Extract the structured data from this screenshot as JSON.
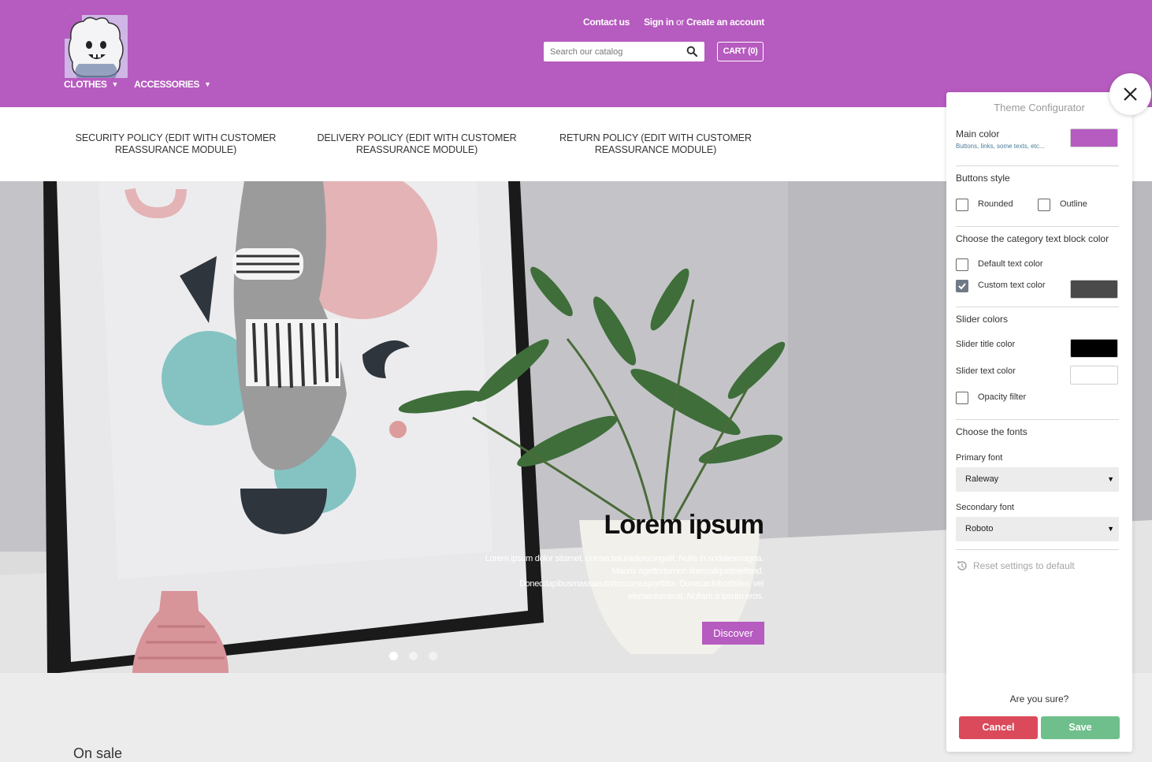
{
  "header": {
    "contact": "Contact us",
    "signin": "Sign in",
    "or": "or",
    "create_account": "Create an account",
    "search_placeholder": "Search our catalog",
    "cart": "CART (0)",
    "menu": [
      {
        "label": "CLOTHES"
      },
      {
        "label": "ACCESSORIES"
      }
    ],
    "brand_color": "#b65bbf"
  },
  "reassurance": [
    {
      "line1": "SECURITY POLICY (EDIT WITH CUSTOMER",
      "line2": "REASSURANCE MODULE)"
    },
    {
      "line1": "DELIVERY POLICY (EDIT WITH CUSTOMER",
      "line2": "REASSURANCE MODULE)"
    },
    {
      "line1": "RETURN POLICY (EDIT WITH CUSTOMER",
      "line2": "REASSURANCE MODULE)"
    }
  ],
  "hero": {
    "title": "Lorem ipsum",
    "text": "Lorem ipsum dolor sitamet, consecteturadipiscingelit. Nulla in sodalesmagna. Mauris egettortornon liberoaliqueteleifend. Donecdapibusmassaeutortorcursusporttitor. Donecaclobortisleo, vel elementumerat. Nullam a ipsum eros.",
    "button": "Discover",
    "active_slide": 1,
    "slide_count": 3
  },
  "section": {
    "on_sale": "On sale"
  },
  "configurator": {
    "title": "Theme Configurator",
    "main_color_label": "Main color",
    "main_color_hint": "Buttons, links, some texts, etc...",
    "main_color": "#b65bbf",
    "buttons_style_label": "Buttons style",
    "rounded": "Rounded",
    "outline": "Outline",
    "rounded_checked": false,
    "outline_checked": false,
    "category_color_label": "Choose the category text block color",
    "default_text_color": "Default text color",
    "custom_text_color": "Custom text color",
    "custom_checked": true,
    "custom_text_color_value": "#4a4a4a",
    "slider_colors_label": "Slider colors",
    "slider_title_color_label": "Slider title color",
    "slider_title_color": "#000000",
    "slider_text_color_label": "Slider text color",
    "slider_text_color": "#ffffff",
    "opacity_filter": "Opacity filter",
    "opacity_checked": false,
    "fonts_label": "Choose the fonts",
    "primary_font_label": "Primary font",
    "primary_font": "Raleway",
    "secondary_font_label": "Secondary font",
    "secondary_font": "Roboto",
    "reset": "Reset settings to default",
    "confirm": "Are you sure?",
    "cancel": "Cancel",
    "save": "Save"
  }
}
